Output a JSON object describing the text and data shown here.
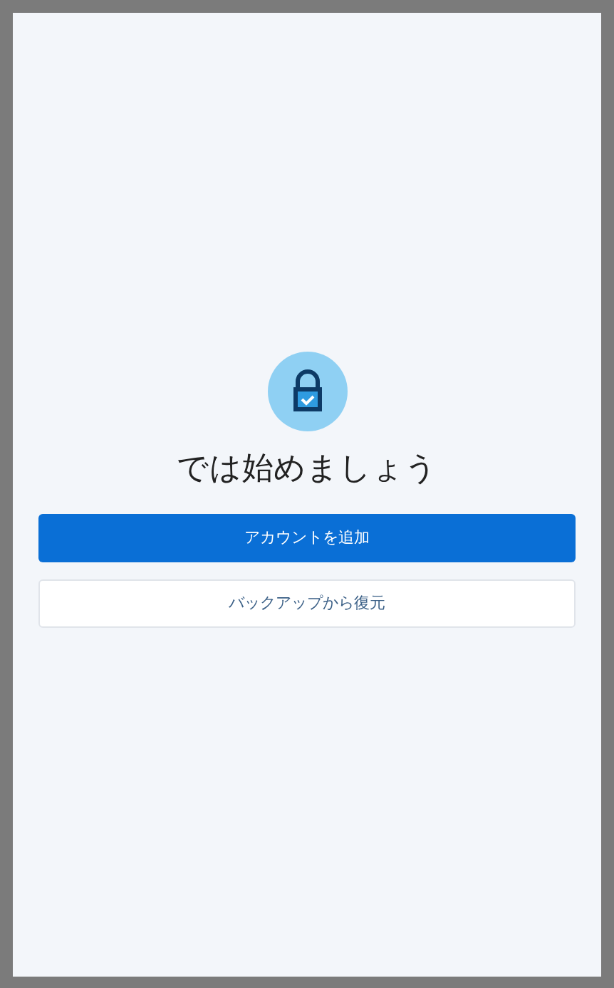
{
  "title": "では始めましょう",
  "buttons": [
    {
      "label": "アカウントを追加",
      "kind": "primary"
    },
    {
      "label": "バックアップから復元",
      "kind": "secondary"
    }
  ]
}
